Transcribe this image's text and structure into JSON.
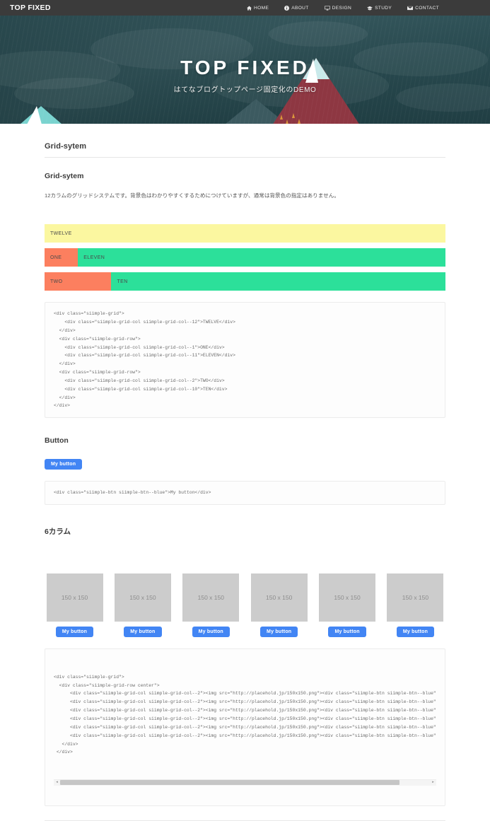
{
  "header": {
    "brand": "TOP FIXED",
    "nav": [
      {
        "label": "HOME",
        "icon": "home-icon"
      },
      {
        "label": "ABOUT",
        "icon": "info-circle-icon"
      },
      {
        "label": "DESIGN",
        "icon": "desktop-icon"
      },
      {
        "label": "STUDY",
        "icon": "graduation-cap-icon"
      },
      {
        "label": "CONTACT",
        "icon": "envelope-icon"
      }
    ]
  },
  "hero": {
    "title": "TOP FIXED",
    "subtitle": "はてなブログトップページ固定化のDEMO"
  },
  "main": {
    "section_title": "Grid-sytem",
    "sub_title": "Grid-sytem",
    "body_text": "12カラムのグリッドシステムです。背景色はわかりやすくするためにつけていますが、通常は背景色の指定はありません。",
    "grid_demo": {
      "rows": [
        [
          {
            "label": "TWELVE",
            "cols": 12,
            "color": "yellow"
          }
        ],
        [
          {
            "label": "ONE",
            "cols": 1,
            "color": "salmon"
          },
          {
            "label": "ELEVEN",
            "cols": 11,
            "color": "green"
          }
        ],
        [
          {
            "label": "TWO",
            "cols": 2,
            "color": "salmon"
          },
          {
            "label": "TEN",
            "cols": 10,
            "color": "green"
          }
        ]
      ]
    },
    "code_grid": "<div class=\"siimple-grid\">\n    <div class=\"siimple-grid-col siimple-grid-col--12\">TWELVE</div>\n  </div>\n  <div class=\"siimple-grid-row\">\n    <div class=\"siimple-grid-col siimple-grid-col--1\">ONE</div>\n    <div class=\"siimple-grid-col siimple-grid-col--11\">ELEVEN</div>\n  </div>\n  <div class=\"siimple-grid-row\">\n    <div class=\"siimple-grid-col siimple-grid-col--2\">TWO</div>\n    <div class=\"siimple-grid-col siimple-grid-col--10\">TEN</div>\n  </div>\n</div>",
    "button_section_title": "Button",
    "button_label": "My button",
    "code_button": "<div class=\"siimple-btn siimple-btn--blue\">My button</div>",
    "columns_title": "6カラム",
    "placeholder_label": "150 x 150",
    "columns": [
      {
        "image_label": "150 x 150",
        "button_label": "My button"
      },
      {
        "image_label": "150 x 150",
        "button_label": "My button"
      },
      {
        "image_label": "150 x 150",
        "button_label": "My button"
      },
      {
        "image_label": "150 x 150",
        "button_label": "My button"
      },
      {
        "image_label": "150 x 150",
        "button_label": "My button"
      },
      {
        "image_label": "150 x 150",
        "button_label": "My button"
      }
    ],
    "code_columns_line1": "<div class=\"siimple-grid\">",
    "code_columns_line2": "  <div class=\"siimple-grid-row center\">",
    "code_columns_item": "      <div class=\"siimple-grid-col siimple-grid-col--2\"><img src=\"http://placehold.jp/150x150.png\"><div class=\"siimple-btn siimple-btn--blue\"",
    "code_columns_close1": "   </div>",
    "code_columns_close2": " </div>",
    "scroll_left_arrow": "◂",
    "scroll_right_arrow": "▸"
  },
  "colors": {
    "navbar_bg": "#3b3b3b",
    "hero_bg": "#26494f",
    "accent_blue": "#4285f4",
    "cell_yellow": "#fbf7a0",
    "cell_salmon": "#fc7f5f",
    "cell_green": "#2ce09a",
    "mountain_red": "#8e3742"
  }
}
